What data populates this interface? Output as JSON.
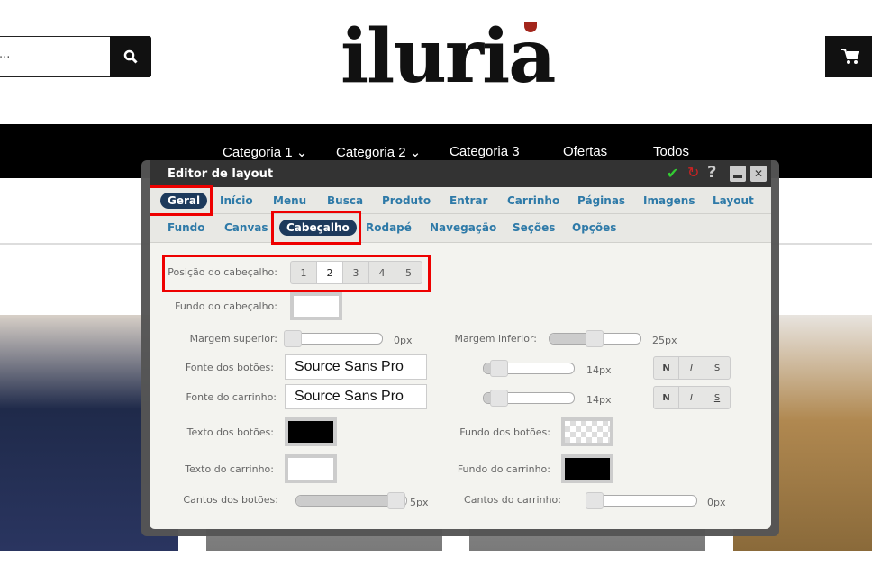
{
  "store": {
    "logo": "iluria",
    "search_placeholder": "...",
    "nav": [
      "Categoria 1",
      "Categoria 2",
      "Categoria 3",
      "Ofertas",
      "Todos"
    ]
  },
  "editor": {
    "title": "Editor de layout",
    "main_tabs": [
      "Geral",
      "Início",
      "Menu",
      "Busca",
      "Produto",
      "Entrar",
      "Carrinho",
      "Páginas",
      "Imagens",
      "Layout"
    ],
    "active_main_tab": "Geral",
    "sub_tabs": [
      "Fundo",
      "Canvas",
      "Cabeçalho",
      "Rodapé",
      "Navegação",
      "Seções",
      "Opções"
    ],
    "active_sub_tab": "Cabeçalho",
    "position": {
      "label": "Posição do cabeçalho:",
      "options": [
        "1",
        "2",
        "3",
        "4",
        "5"
      ],
      "selected": "2"
    },
    "header_bg": {
      "label": "Fundo do cabeçalho:",
      "color": "#ffffff"
    },
    "margin_top": {
      "label": "Margem superior:",
      "value": "0px",
      "level": 0
    },
    "margin_bottom": {
      "label": "Margem inferior:",
      "value": "25px",
      "level": 0.5
    },
    "button_font": {
      "label": "Fonte dos botões:",
      "value": "Source Sans Pro",
      "size": "14px",
      "level": 0.1
    },
    "cart_font": {
      "label": "Fonte do carrinho:",
      "value": "Source Sans Pro",
      "size": "14px",
      "level": 0.1
    },
    "style_buttons": [
      "N",
      "I",
      "S"
    ],
    "button_text": {
      "label": "Texto dos botões:",
      "color": "#000000"
    },
    "button_bg": {
      "label": "Fundo dos botões:",
      "color": "transparent"
    },
    "cart_text": {
      "label": "Texto do carrinho:",
      "color": "#ffffff"
    },
    "cart_bg": {
      "label": "Fundo do carrinho:",
      "color": "#000000"
    },
    "button_corners": {
      "label": "Cantos dos botões:",
      "value": "5px",
      "level": 1
    },
    "cart_corners": {
      "label": "Cantos do carrinho:",
      "value": "0px",
      "level": 0
    }
  },
  "colors": {
    "accent": "#1d3a5c",
    "tab_text": "#2e7aa8",
    "highlight": "#e00000"
  }
}
